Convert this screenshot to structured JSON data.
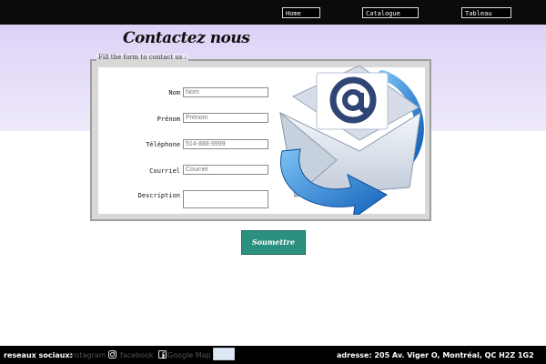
{
  "nav": {
    "items": [
      {
        "label": "Home"
      },
      {
        "label": "Catalogue"
      },
      {
        "label": "Tableau"
      }
    ]
  },
  "page": {
    "title": "Contactez nous"
  },
  "form": {
    "legend": "Fill the form to contact us :",
    "fields": [
      {
        "label": "Nom",
        "placeholder": "Nom"
      },
      {
        "label": "Prénom",
        "placeholder": "Prénom"
      },
      {
        "label": "Téléphone",
        "placeholder": "514-888-9999"
      },
      {
        "label": "Courriel",
        "placeholder": "Courriel"
      },
      {
        "label": "Description",
        "placeholder": ""
      }
    ],
    "submit_label": "Soumettre"
  },
  "footer": {
    "social_label": "reseaux sociaux:",
    "links": [
      {
        "label": "instagram"
      },
      {
        "label": "facebook"
      },
      {
        "label": "Google Map"
      }
    ],
    "address": "adresse: 205 Av. Viger O, Montréal, QC H2Z 1G2"
  },
  "colors": {
    "topbar": "#0b0b0b",
    "band": "#ddd2f6",
    "submit": "#2c907e",
    "envelope_blue": "#1f7fd6"
  },
  "icons": {
    "illustration": "email-envelope-at-icon",
    "instagram": "instagram-icon",
    "facebook": "facebook-icon",
    "map": "map-image"
  }
}
